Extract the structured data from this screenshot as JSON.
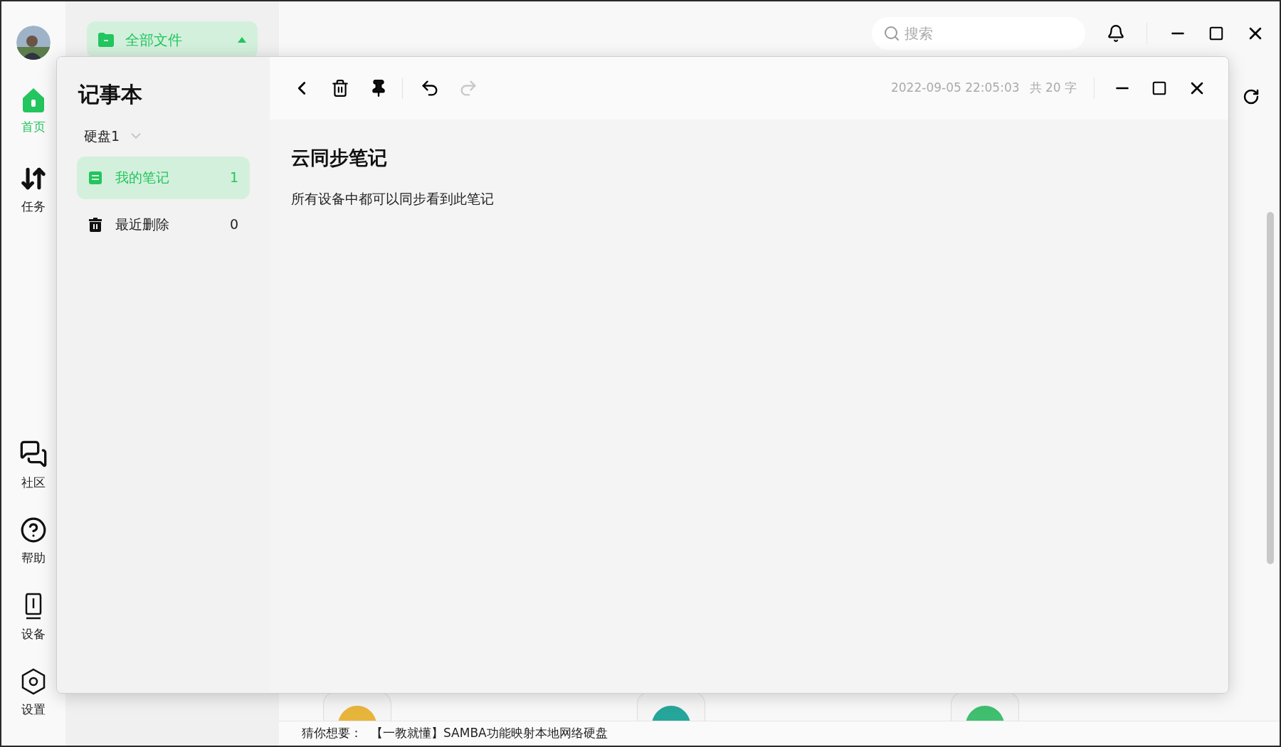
{
  "sidebar": {
    "items": [
      {
        "kind": "home",
        "label": "首页",
        "selected": true
      },
      {
        "kind": "tasks",
        "label": "任务",
        "selected": false
      },
      {
        "kind": "community",
        "label": "社区",
        "selected": false
      },
      {
        "kind": "help",
        "label": "帮助",
        "selected": false
      },
      {
        "kind": "device",
        "label": "设备",
        "selected": false
      },
      {
        "kind": "settings",
        "label": "设置",
        "selected": false
      }
    ]
  },
  "files_button": {
    "label": "全部文件",
    "expanded": true
  },
  "search": {
    "placeholder": "搜索"
  },
  "suggestion": {
    "label": "猜你想要：",
    "link": "【一教就懂】SAMBA功能映射本地网络硬盘"
  },
  "notepad": {
    "title": "记事本",
    "disk": "硬盘1",
    "folders": [
      {
        "kind": "notes",
        "name": "我的笔记",
        "count": "1",
        "selected": true
      },
      {
        "kind": "trash",
        "name": "最近删除",
        "count": "0",
        "selected": false
      }
    ],
    "toolbar": {
      "redo_disabled": true
    },
    "timestamp": "2022-09-05 22:05:03",
    "word_count": "共 20 字",
    "note": {
      "title": "云同步笔记",
      "body": "所有设备中都可以同步看到此笔记"
    }
  }
}
